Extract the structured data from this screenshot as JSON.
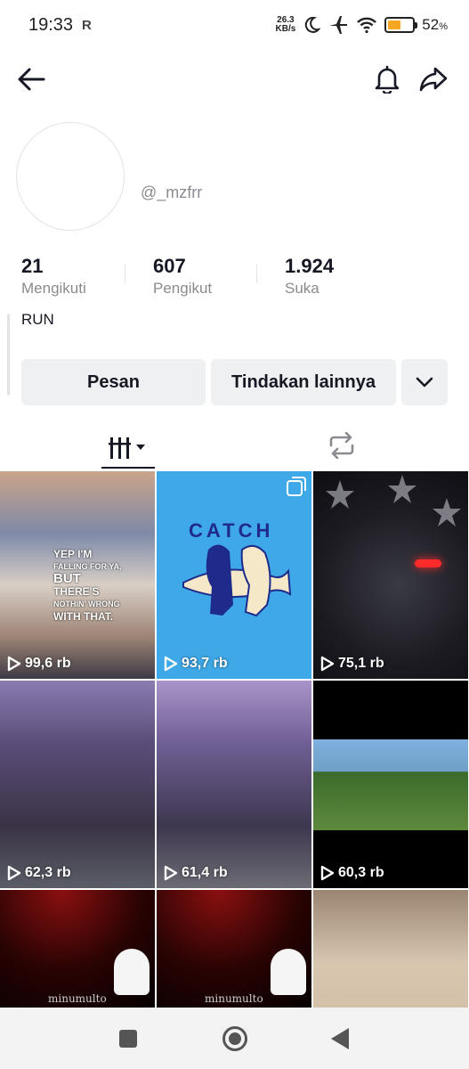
{
  "status_bar": {
    "time": "19:33",
    "carrier_icon": "R",
    "net_speed_value": "26.3",
    "net_speed_unit": "KB/s",
    "battery_percent": "52",
    "battery_percent_sign": "%",
    "battery_level": 0.52,
    "icons": [
      "moon-icon",
      "airplane-icon",
      "wifi-icon",
      "battery-icon"
    ]
  },
  "header": {
    "back_icon": "arrow-left-icon",
    "bell_icon": "bell-icon",
    "share_icon": "share-arrow-icon"
  },
  "profile": {
    "username": "@_mzfrr",
    "stats": [
      {
        "value": "21",
        "label": "Mengikuti"
      },
      {
        "value": "607",
        "label": "Pengikut"
      },
      {
        "value": "1.924",
        "label": "Suka"
      }
    ],
    "bio": "RUN"
  },
  "actions": {
    "message_label": "Pesan",
    "more_actions_label": "Tindakan lainnya",
    "dropdown_icon": "chevron-down-icon"
  },
  "tabs": {
    "videos_icon": "grid-columns-icon",
    "repost_icon": "repost-icon"
  },
  "videos": [
    {
      "views": "99,6 rb",
      "meme_lines": [
        "YEP I'M",
        "FALLING FOR YA,",
        "BUT",
        "THERE'S",
        "NOTHIN' WRONG",
        "WITH THAT."
      ]
    },
    {
      "views": "93,7 rb",
      "caption": "CATCH",
      "multi": true
    },
    {
      "views": "75,1 rb"
    },
    {
      "views": "62,3 rb"
    },
    {
      "views": "61,4 rb"
    },
    {
      "views": "60,3 rb"
    },
    {
      "views": "",
      "overlay_text": "minumulto"
    },
    {
      "views": "",
      "overlay_text": "minumulto"
    },
    {
      "views": ""
    }
  ],
  "nav": {
    "recents_icon": "square-icon",
    "home_icon": "circle-home-icon",
    "back_icon": "triangle-back-icon"
  }
}
